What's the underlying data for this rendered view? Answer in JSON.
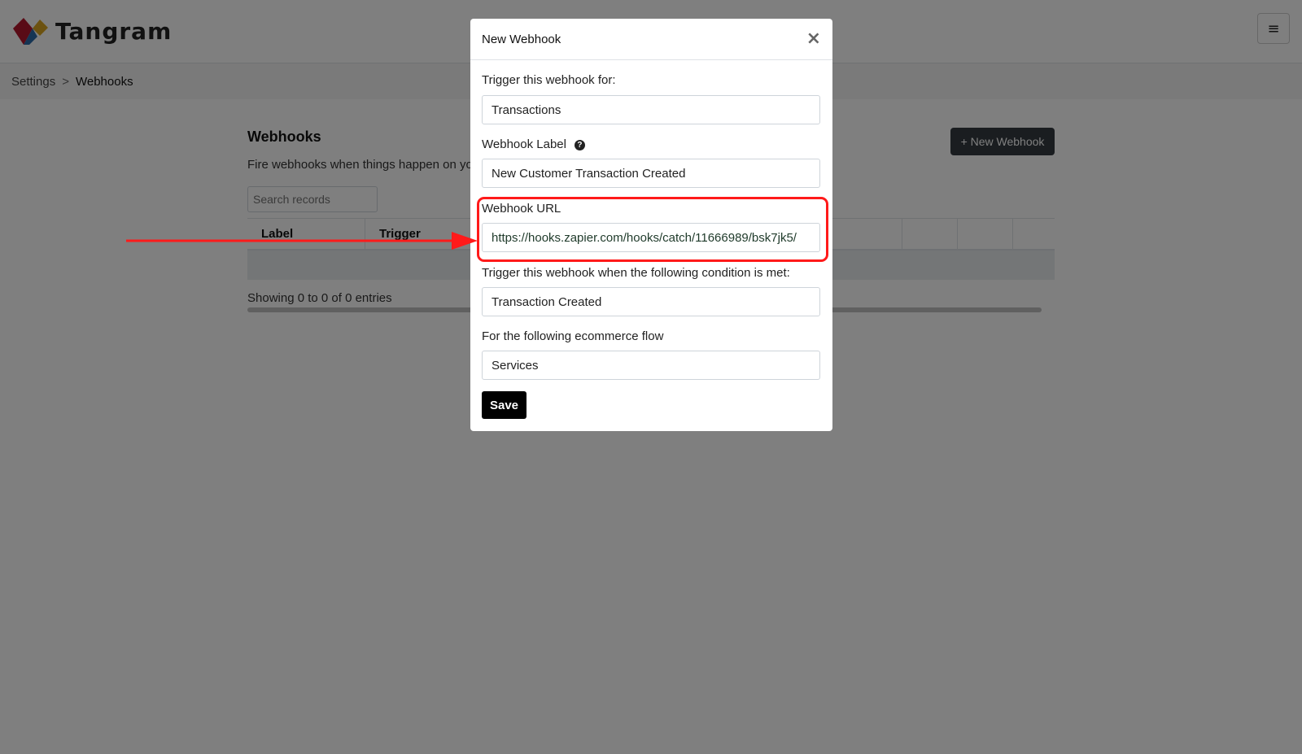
{
  "app": {
    "name": "Tangram",
    "menu_icon": "hamburger-menu-icon",
    "menu_glyph": "≡"
  },
  "breadcrumb": {
    "parent": "Settings",
    "separator": ">",
    "current": "Webhooks"
  },
  "page": {
    "title": "Webhooks",
    "description": "Fire webhooks when things happen on your",
    "new_button_label": "+ New Webhook",
    "search_placeholder": "Search records",
    "table": {
      "columns": [
        "Label",
        "Trigger"
      ]
    },
    "showing_text": "Showing 0 to 0 of 0 entries"
  },
  "modal": {
    "title": "New Webhook",
    "close_glyph": "×",
    "fields": {
      "trigger_for": {
        "label": "Trigger this webhook for:",
        "value": "Transactions"
      },
      "label": {
        "label": "Webhook Label",
        "value": "New Customer Transaction Created",
        "help_glyph": "?"
      },
      "url": {
        "label": "Webhook URL",
        "value": "https://hooks.zapier.com/hooks/catch/11666989/bsk7jk5/"
      },
      "condition": {
        "label": "Trigger this webhook when the following condition is met:",
        "value": "Transaction Created"
      },
      "flow": {
        "label": "For the following ecommerce flow",
        "value": "Services"
      }
    },
    "save_label": "Save"
  },
  "colors": {
    "annotation": "#ff1a1a",
    "primary_dark": "#343a40",
    "save_button": "#000000"
  }
}
